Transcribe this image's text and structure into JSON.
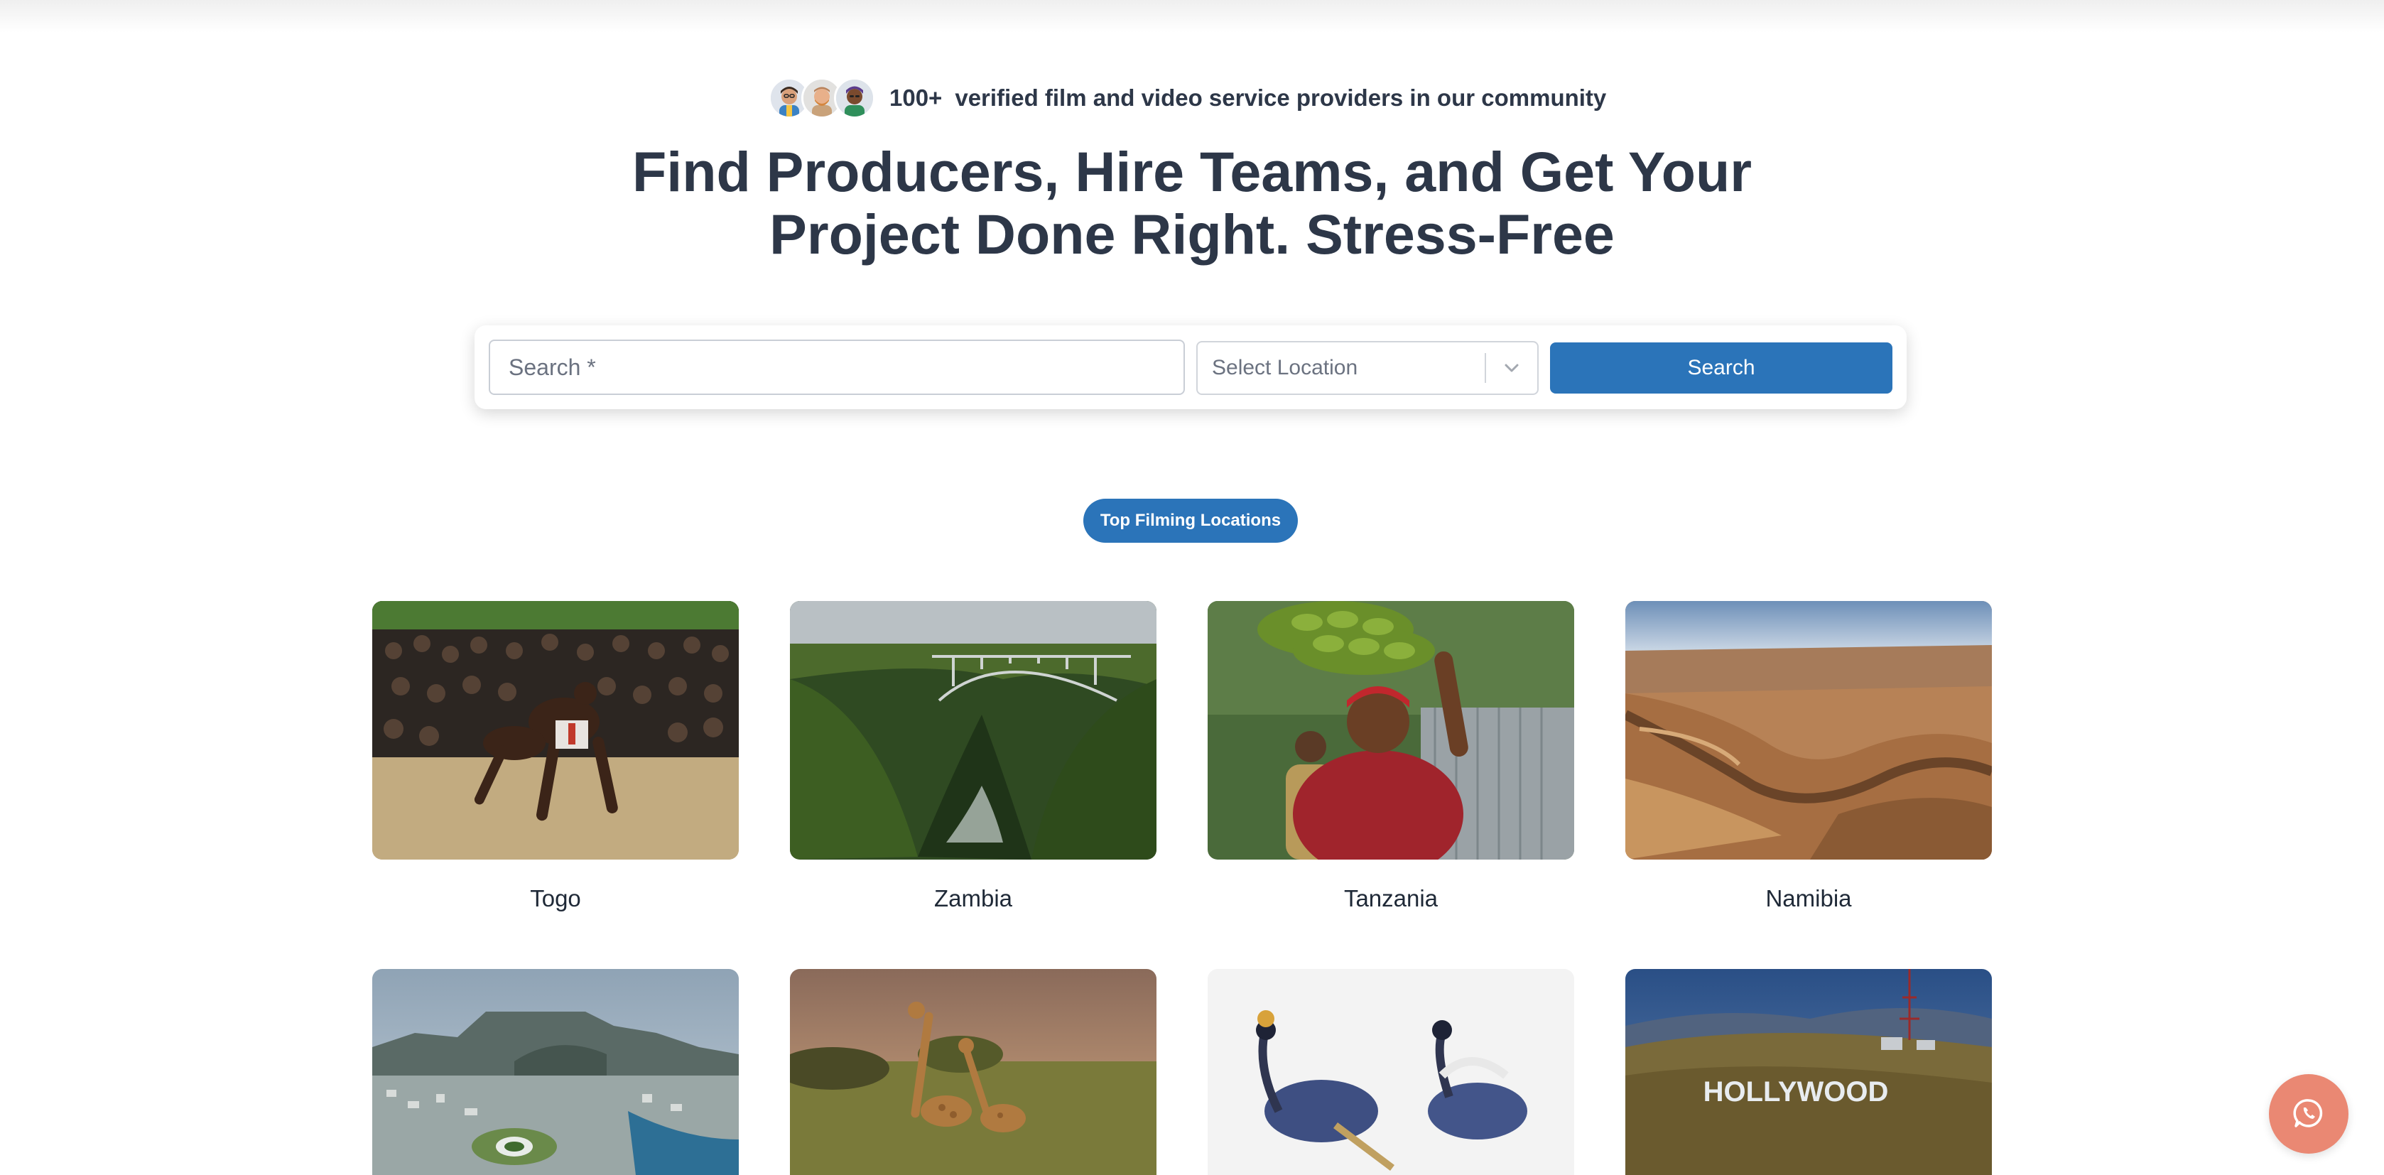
{
  "hero": {
    "community_count": "100+",
    "community_text": "verified film and video service providers in our community",
    "headline_line1": "Find Producers, Hire Teams, and Get Your",
    "headline_line2": "Project Done Right. Stress-Free"
  },
  "search": {
    "input_placeholder": "Search *",
    "location_placeholder": "Select Location",
    "button_label": "Search"
  },
  "section": {
    "pill_label": "Top Filming Locations"
  },
  "locations": [
    {
      "name": "Togo"
    },
    {
      "name": "Zambia"
    },
    {
      "name": "Tanzania"
    },
    {
      "name": "Namibia"
    },
    {
      "name": ""
    },
    {
      "name": ""
    },
    {
      "name": ""
    },
    {
      "name": "",
      "sign_text": "HOLLYWOOD"
    }
  ],
  "icons": {
    "chevron": "chevron-down-icon",
    "chat": "whatsapp-icon"
  },
  "colors": {
    "primary": "#2b74b9",
    "text": "#2d3748",
    "chat_button": "#ea8873"
  }
}
